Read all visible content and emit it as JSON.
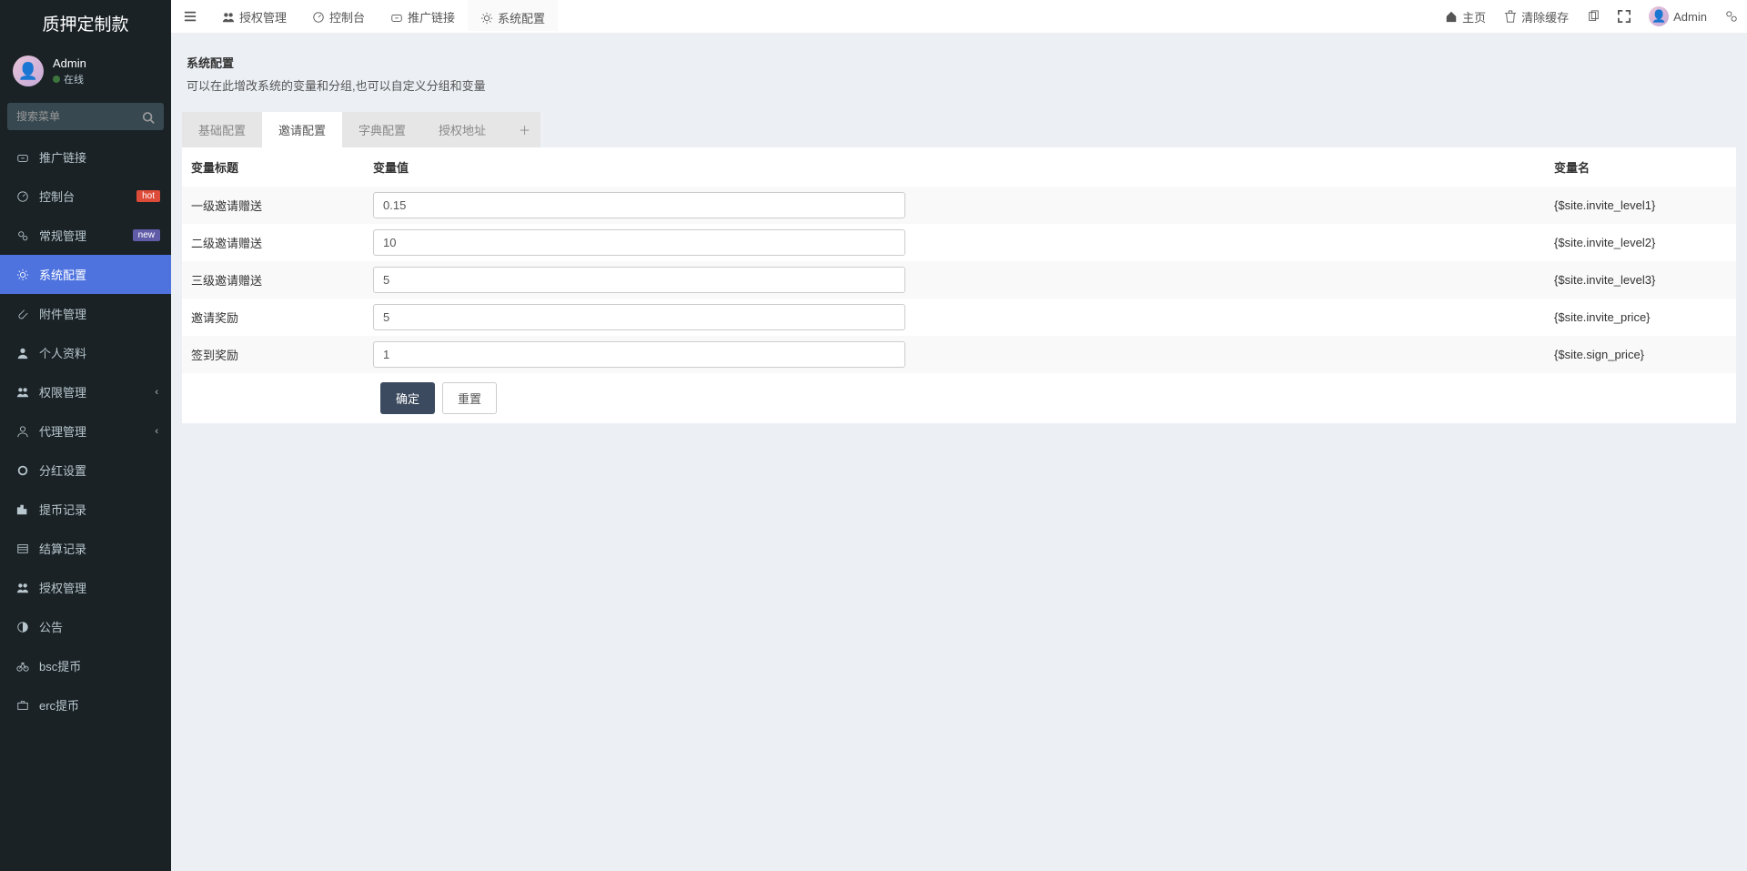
{
  "brand": "质押定制款",
  "user": {
    "name": "Admin",
    "status": "在线"
  },
  "search": {
    "placeholder": "搜索菜单"
  },
  "sidebar": {
    "items": [
      {
        "icon": "link",
        "label": "推广链接",
        "badge": ""
      },
      {
        "icon": "dash",
        "label": "控制台",
        "badge": "hot"
      },
      {
        "icon": "cogs",
        "label": "常规管理",
        "badge": "new"
      },
      {
        "icon": "cog",
        "label": "系统配置",
        "badge": "",
        "active": true
      },
      {
        "icon": "clip",
        "label": "附件管理",
        "badge": ""
      },
      {
        "icon": "user",
        "label": "个人资料",
        "badge": ""
      },
      {
        "icon": "users",
        "label": "权限管理",
        "badge": "",
        "expand": true
      },
      {
        "icon": "usero",
        "label": "代理管理",
        "badge": "",
        "expand": true
      },
      {
        "icon": "circle",
        "label": "分红设置",
        "badge": ""
      },
      {
        "icon": "bars",
        "label": "提币记录",
        "badge": ""
      },
      {
        "icon": "list",
        "label": "结算记录",
        "badge": ""
      },
      {
        "icon": "users",
        "label": "授权管理",
        "badge": ""
      },
      {
        "icon": "half",
        "label": "公告",
        "badge": ""
      },
      {
        "icon": "bike",
        "label": "bsc提币",
        "badge": ""
      },
      {
        "icon": "case",
        "label": "erc提币",
        "badge": ""
      }
    ]
  },
  "topnav": {
    "left": [
      {
        "icon": "users",
        "label": "授权管理"
      },
      {
        "icon": "dash",
        "label": "控制台"
      },
      {
        "icon": "link",
        "label": "推广链接"
      },
      {
        "icon": "cog",
        "label": "系统配置",
        "active": true
      }
    ],
    "right": {
      "home": "主页",
      "clear_cache": "清除缓存",
      "user": "Admin"
    }
  },
  "page": {
    "title": "系统配置",
    "desc": "可以在此增改系统的变量和分组,也可以自定义分组和变量",
    "tabs": [
      "基础配置",
      "邀请配置",
      "字典配置",
      "授权地址"
    ],
    "active_tab": 1,
    "columns": {
      "title": "变量标题",
      "value": "变量值",
      "name": "变量名"
    },
    "rows": [
      {
        "title": "一级邀请赠送",
        "value": "0.15",
        "name": "{$site.invite_level1}"
      },
      {
        "title": "二级邀请赠送",
        "value": "10",
        "name": "{$site.invite_level2}"
      },
      {
        "title": "三级邀请赠送",
        "value": "5",
        "name": "{$site.invite_level3}"
      },
      {
        "title": "邀请奖励",
        "value": "5",
        "name": "{$site.invite_price}"
      },
      {
        "title": "签到奖励",
        "value": "1",
        "name": "{$site.sign_price}"
      }
    ],
    "buttons": {
      "ok": "确定",
      "reset": "重置"
    }
  }
}
